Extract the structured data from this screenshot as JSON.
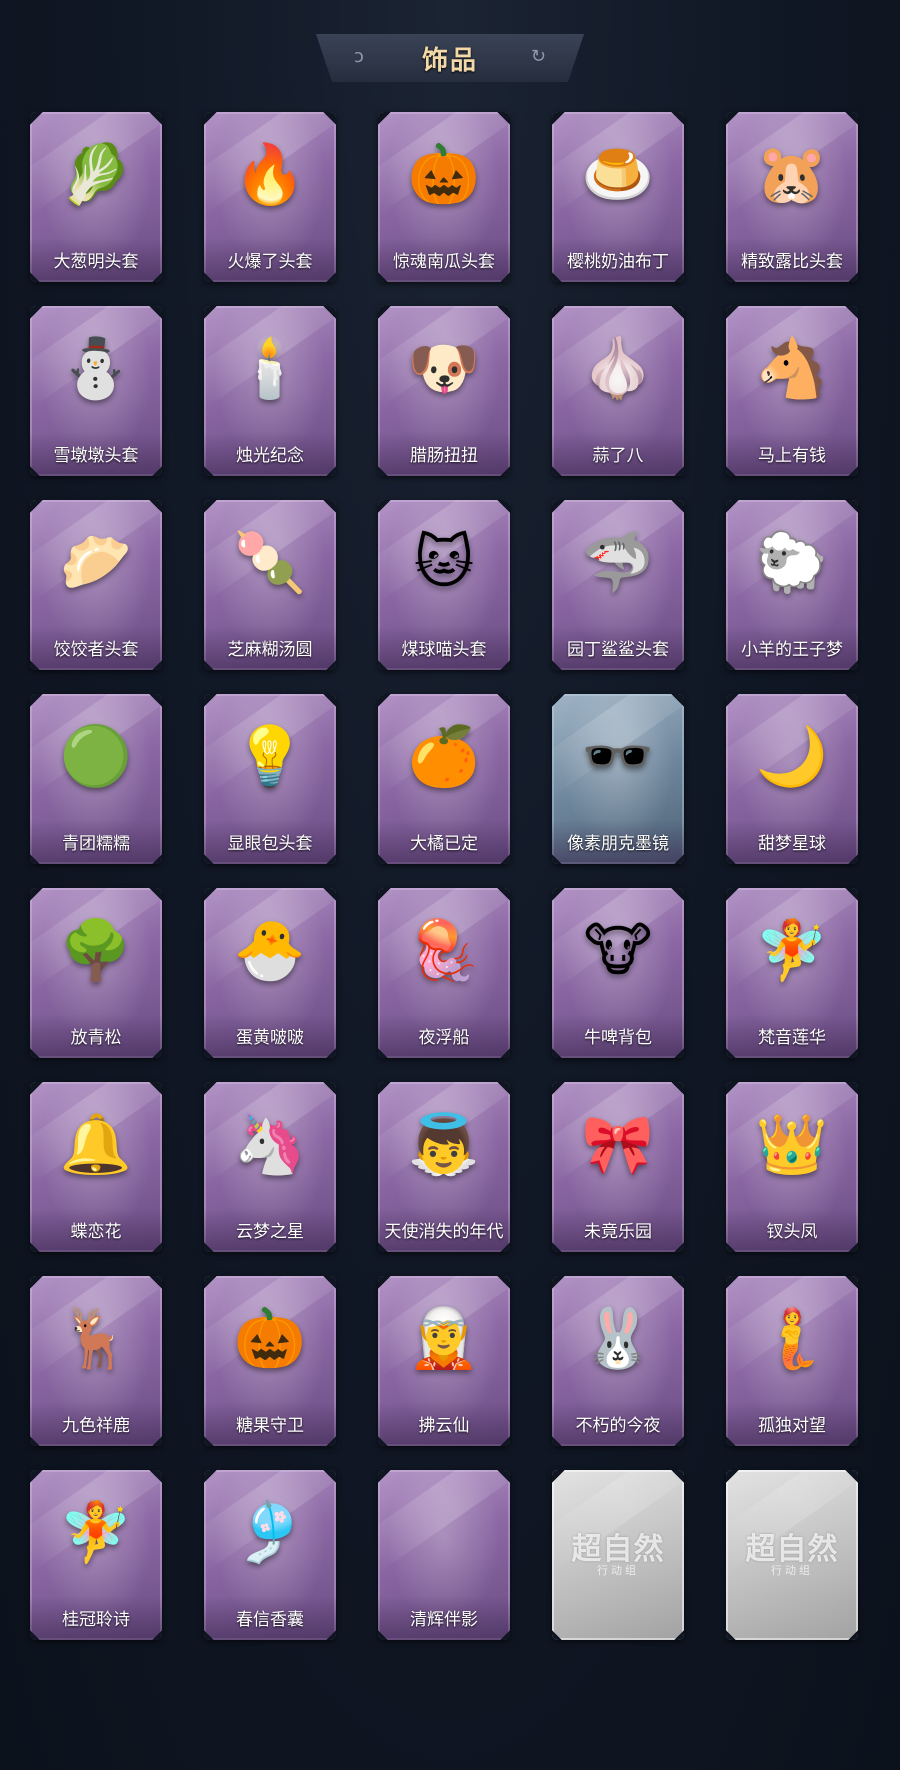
{
  "header": {
    "title": "饰品"
  },
  "items": [
    {
      "label": "大葱明头套",
      "icon": "🥬"
    },
    {
      "label": "火爆了头套",
      "icon": "🔥"
    },
    {
      "label": "惊魂南瓜头套",
      "icon": "🎃"
    },
    {
      "label": "樱桃奶油布丁",
      "icon": "🍮"
    },
    {
      "label": "精致露比头套",
      "icon": "🐹"
    },
    {
      "label": "雪墩墩头套",
      "icon": "⛄"
    },
    {
      "label": "烛光纪念",
      "icon": "🕯️"
    },
    {
      "label": "腊肠扭扭",
      "icon": "🐶"
    },
    {
      "label": "蒜了八",
      "icon": "🧄"
    },
    {
      "label": "马上有钱",
      "icon": "🐴"
    },
    {
      "label": "饺饺者头套",
      "icon": "🥟"
    },
    {
      "label": "芝麻糊汤圆",
      "icon": "🍡"
    },
    {
      "label": "煤球喵头套",
      "icon": "🐱"
    },
    {
      "label": "园丁鲨鲨头套",
      "icon": "🦈"
    },
    {
      "label": "小羊的王子梦",
      "icon": "🐑"
    },
    {
      "label": "青团糯糯",
      "icon": "🟢"
    },
    {
      "label": "显眼包头套",
      "icon": "💡"
    },
    {
      "label": "大橘已定",
      "icon": "🍊"
    },
    {
      "label": "像素朋克墨镜",
      "icon": "🕶️",
      "style": "blue"
    },
    {
      "label": "甜梦星球",
      "icon": "🌙"
    },
    {
      "label": "放青松",
      "icon": "🌳"
    },
    {
      "label": "蛋黄啵啵",
      "icon": "🐣"
    },
    {
      "label": "夜浮船",
      "icon": "🪼"
    },
    {
      "label": "牛啤背包",
      "icon": "🐮"
    },
    {
      "label": "梵音莲华",
      "icon": "🧚"
    },
    {
      "label": "蝶恋花",
      "icon": "🔔"
    },
    {
      "label": "云梦之星",
      "icon": "🦄"
    },
    {
      "label": "天使消失的年代",
      "icon": "👼"
    },
    {
      "label": "未竟乐园",
      "icon": "🎀"
    },
    {
      "label": "钗头凤",
      "icon": "👑"
    },
    {
      "label": "九色祥鹿",
      "icon": "🦌"
    },
    {
      "label": "糖果守卫",
      "icon": "🎃"
    },
    {
      "label": "拂云仙",
      "icon": "🧝"
    },
    {
      "label": "不朽的今夜",
      "icon": "🐰"
    },
    {
      "label": "孤独对望",
      "icon": "🧜"
    },
    {
      "label": "桂冠聆诗",
      "icon": "🧚"
    },
    {
      "label": "春信香囊",
      "icon": "🎐"
    },
    {
      "label": "清辉伴影",
      "icon": ""
    },
    {
      "label": "",
      "icon": "",
      "style": "locked",
      "watermark": "超自然",
      "watermark_sub": "行动组"
    },
    {
      "label": "",
      "icon": "",
      "style": "locked",
      "watermark": "超自然",
      "watermark_sub": "行动组"
    }
  ],
  "colors": {
    "background": "#0f1622",
    "card_purple": "#8b67a3",
    "card_blue": "#6f879d",
    "card_locked": "#bdbdbd",
    "banner_text": "#f3d9a8"
  }
}
